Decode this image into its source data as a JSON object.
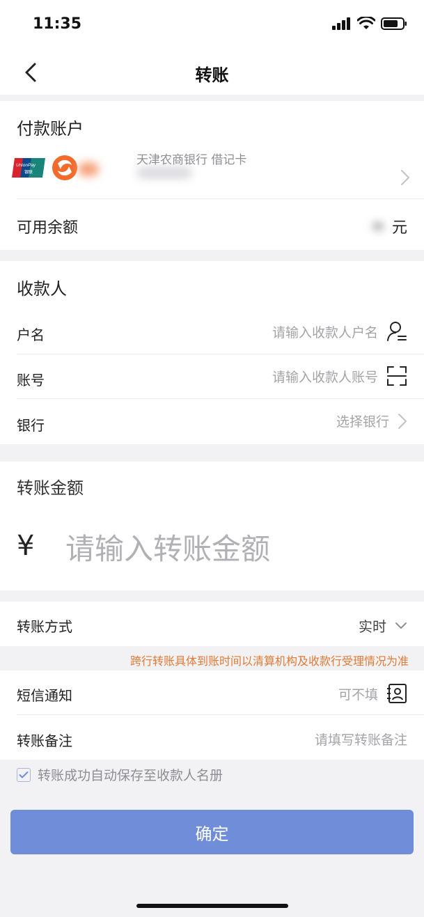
{
  "status_bar": {
    "time": "11:35"
  },
  "nav": {
    "title": "转账"
  },
  "payment_account": {
    "section_title": "付款账户",
    "bank_name": "天津农商银行 借记卡",
    "balance_label": "可用余额",
    "balance_unit": "元"
  },
  "payee": {
    "section_title": "收款人",
    "name_label": "户名",
    "name_placeholder": "请输入收款人户名",
    "account_label": "账号",
    "account_placeholder": "请输入收款人账号",
    "bank_label": "银行",
    "bank_placeholder": "选择银行"
  },
  "amount": {
    "section_title": "转账金额",
    "currency_symbol": "¥",
    "placeholder": "请输入转账金额"
  },
  "options": {
    "method_label": "转账方式",
    "method_value": "实时",
    "notice": "跨行转账具体到账时间以清算机构及收款行受理情况为准",
    "sms_label": "短信通知",
    "sms_placeholder": "可不填",
    "remark_label": "转账备注",
    "remark_placeholder": "请填写转账备注"
  },
  "save_payee": {
    "label": "转账成功自动保存至收款人名册",
    "checked": true
  },
  "confirm_button": "确定",
  "colors": {
    "accent": "#6f8dd9",
    "notice": "#e07a35",
    "placeholder": "#a4a4a8"
  }
}
